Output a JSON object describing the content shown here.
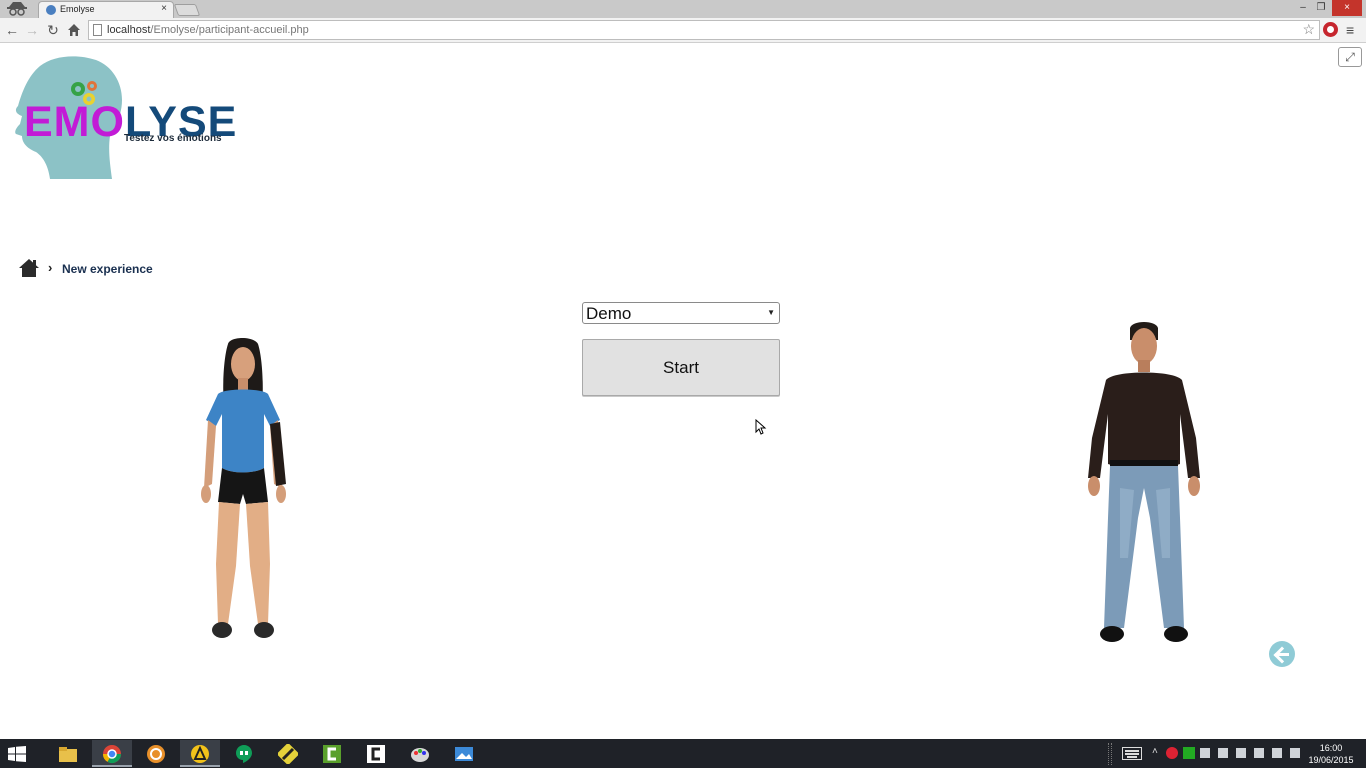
{
  "browser": {
    "tab_title": "Emolyse",
    "tab_close": "×",
    "url_host": "localhost",
    "url_path": "/Emolyse/participant-accueil.php",
    "window_min": "–",
    "window_max": "❐",
    "window_close": "×"
  },
  "logo": {
    "word_part1": "EMO",
    "word_part2": "LYSE",
    "tagline": "Testez vos émotions"
  },
  "breadcrumb": {
    "separator": "›",
    "current": "New experience"
  },
  "experience_select": {
    "value": "Demo"
  },
  "start_button": {
    "label": "Start"
  },
  "taskbar": {
    "clock_time": "16:00",
    "clock_date": "19/06/2015"
  },
  "colors": {
    "logo_purple": "#c21bd6",
    "logo_navy": "#144a7a",
    "logo_head": "#8cc2c6",
    "back_button": "#8fcbd6"
  }
}
